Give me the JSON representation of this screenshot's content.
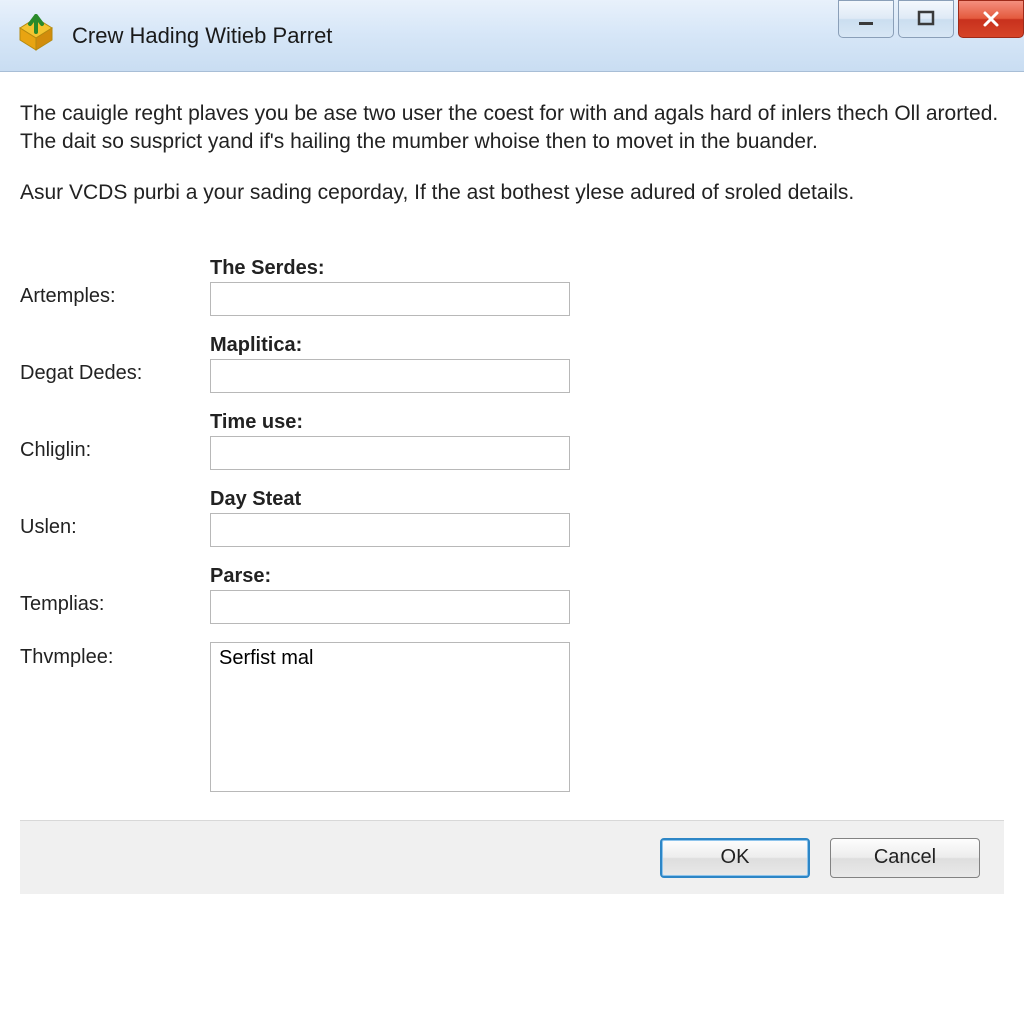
{
  "window": {
    "title": "Crew Hading Witieb Parret"
  },
  "intro": {
    "p1": "The cauigle reght plaves you be ase two user the coest for with and agals hard of inlers thech Oll arorted. The dait so susprict yand if's hailing the mumber whoise then to movet in the buander.",
    "p2": "Asur VCDS purbi a your sading ceporday, If the ast bothest ylese adured of sroled details."
  },
  "form": {
    "rows": [
      {
        "left": "Artemples:",
        "label": "The Serdes:",
        "value": "",
        "type": "text"
      },
      {
        "left": "Degat Dedes:",
        "label": "Maplitica:",
        "value": "",
        "type": "text"
      },
      {
        "left": "Chliglin:",
        "label": "Time use:",
        "value": "",
        "type": "text"
      },
      {
        "left": "Uslen:",
        "label": "Day Steat",
        "value": "",
        "type": "text"
      },
      {
        "left": "Templias:",
        "label": "Parse:",
        "value": "",
        "type": "text"
      },
      {
        "left": "Thvmplee:",
        "label": "",
        "value": "Serfist mal",
        "type": "textarea"
      }
    ]
  },
  "footer": {
    "ok": "OK",
    "cancel": "Cancel"
  }
}
